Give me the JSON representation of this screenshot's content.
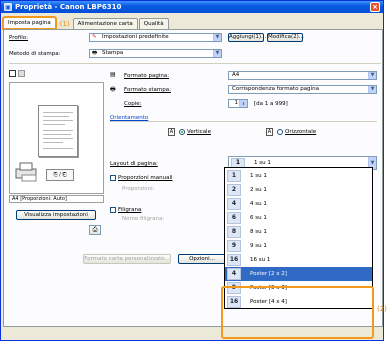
{
  "window": {
    "title": "Proprietà - Canon LBP6310",
    "close": "×"
  },
  "tabs": [
    {
      "label": "Imposta pagina",
      "active": true
    },
    {
      "label": "Alimentazione carta",
      "active": false
    },
    {
      "label": "Qualità",
      "active": false
    }
  ],
  "callouts": {
    "one": "(1)",
    "two": "(2)"
  },
  "profile": {
    "label": "Profilo:",
    "value": "Impostazioni predefinite",
    "add_button": "Aggiungi(1)...",
    "edit_button": "Modifica(2)..."
  },
  "output_method": {
    "label": "Metodo di stampa:",
    "value": "Stampa"
  },
  "page_size": {
    "label": "Formato pagina:",
    "value": "A4"
  },
  "output_size": {
    "label": "Formato stampa:",
    "value": "Corrispondenza formato pagina"
  },
  "copies": {
    "label": "Copie:",
    "value": "1",
    "range": "[da 1 a 999]"
  },
  "orientation": {
    "label": "Orientamento",
    "portrait": "Verticale",
    "landscape": "Orizzontale",
    "selected": "portrait"
  },
  "layout": {
    "label": "Layout di pagina:",
    "selected_num": "1",
    "selected_label": "1 su 1"
  },
  "manual_scaling": {
    "label": "Proporzioni manuali",
    "sub_label": "Proporzioni:"
  },
  "watermark": {
    "label": "Filigrana",
    "sub_label": "Nome filigrana:"
  },
  "preview_caption": "A4 [Proporzioni: Auto]",
  "view_settings_button": "Visualizza impostazioni",
  "custom_paper_button": "Formato carta personalizzato...",
  "options_button": "Opzioni...",
  "dropdown_items": [
    {
      "num": "1",
      "label": "1 su 1",
      "selected": false
    },
    {
      "num": "2",
      "label": "2 su 1",
      "selected": false
    },
    {
      "num": "4",
      "label": "4 su 1",
      "selected": false
    },
    {
      "num": "6",
      "label": "6 su 1",
      "selected": false
    },
    {
      "num": "8",
      "label": "8 su 1",
      "selected": false
    },
    {
      "num": "9",
      "label": "9 su 1",
      "selected": false
    },
    {
      "num": "16",
      "label": "16 su 1",
      "selected": false
    },
    {
      "num": "4",
      "label": "Poster [2 x 2]",
      "selected": true
    },
    {
      "num": "9",
      "label": "Poster [3 x 3]",
      "selected": false
    },
    {
      "num": "16",
      "label": "Poster [4 x 4]",
      "selected": false
    }
  ],
  "colors": {
    "accent": "#f39a1e",
    "selection": "#316ac5",
    "titlebar": "#0a5ae2"
  }
}
